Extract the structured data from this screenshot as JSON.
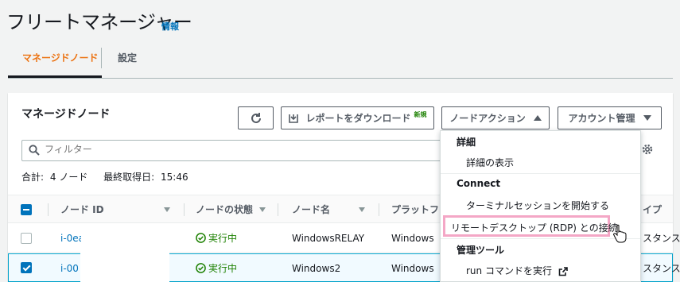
{
  "header": {
    "title": "フリートマネージャー",
    "info": "情報"
  },
  "tabs": [
    {
      "label": "マネージドノード"
    },
    {
      "label": "設定"
    }
  ],
  "panel": {
    "title": "マネージドノード",
    "buttons": {
      "refresh_icon": "refresh-icon",
      "download_label": "レポートをダウンロード",
      "download_badge": "新規",
      "actions_label": "ノードアクション",
      "account_label": "アカウント管理"
    },
    "search": {
      "placeholder": "フィルター"
    },
    "summary": {
      "total_label": "合計:",
      "total_value": "4 ノード",
      "last_label": "最終取得日:",
      "last_value": "15:46"
    },
    "columns": [
      "ノード ID",
      "ノードの状態",
      "ノード名",
      "プラットフォ",
      "イプ"
    ],
    "rows": [
      {
        "id": "i-0ea",
        "status": "実行中",
        "name": "WindowsRELAY",
        "platform": "Windows",
        "type": "スタンス",
        "selected": false
      },
      {
        "id": "i-00",
        "status": "実行中",
        "name": "Windows2",
        "platform": "Windows",
        "type": "スタンス",
        "selected": true
      }
    ]
  },
  "dropdown": {
    "groups": [
      {
        "label": "詳細",
        "items": [
          "詳細の表示"
        ]
      },
      {
        "label": "Connect",
        "items": [
          "ターミナルセッションを開始する",
          "リモートデスクトップ (RDP) との接続"
        ]
      },
      {
        "label": "管理ツール",
        "items": [
          "run コマンドを実行"
        ]
      }
    ]
  },
  "colors": {
    "accent": "#ec7211",
    "link": "#0073bb",
    "success": "#1d8102",
    "highlight": "#f4a7c6"
  }
}
